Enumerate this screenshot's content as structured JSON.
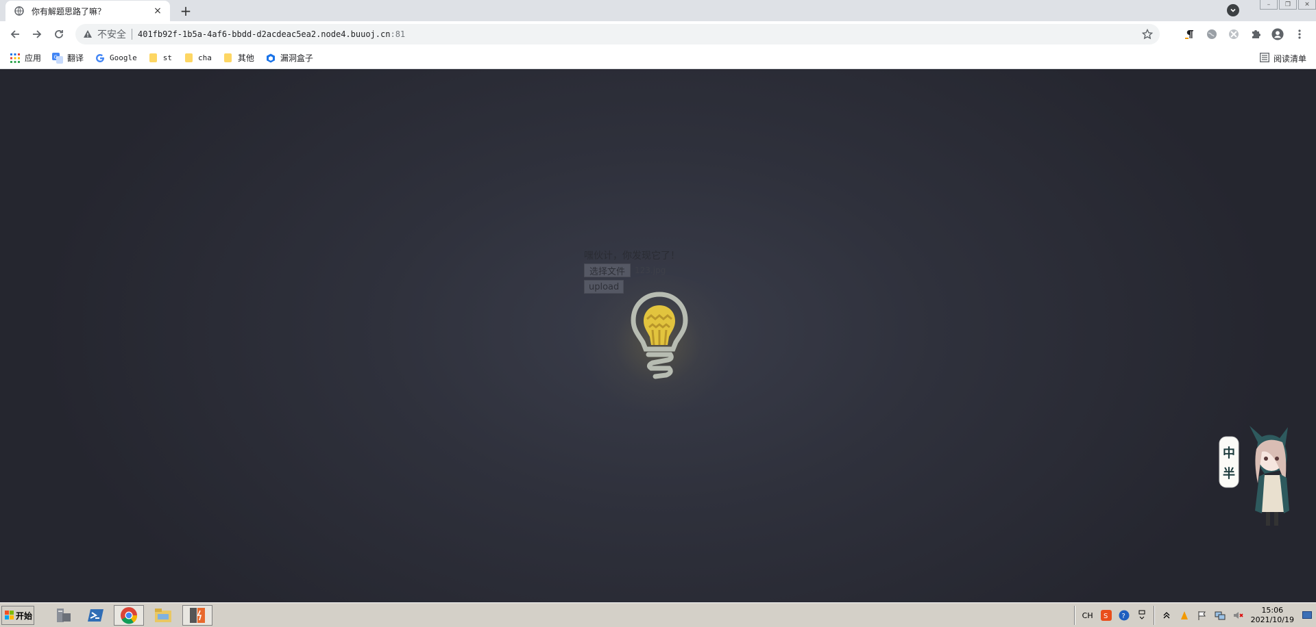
{
  "browser": {
    "tab": {
      "title": "你有解题思路了嘛？",
      "close": "×"
    },
    "new_tab": "+",
    "address": {
      "security_label": "不安全",
      "url_host": "401fb92f-1b5a-4af6-bbdd-d2acdeac5ea2.node4.buuoj.cn",
      "url_port": ":81"
    },
    "bookmarks": [
      {
        "label": "应用",
        "icon": "apps-grid-icon"
      },
      {
        "label": "翻译",
        "icon": "translate-icon"
      },
      {
        "label": "Google",
        "icon": "google-icon"
      },
      {
        "label": "st",
        "icon": "folder-icon"
      },
      {
        "label": "cha",
        "icon": "folder-icon"
      },
      {
        "label": "其他",
        "icon": "folder-icon"
      },
      {
        "label": "漏洞盒子",
        "icon": "vulbox-icon"
      }
    ],
    "reading_list": "阅读清单"
  },
  "page": {
    "hint": "嘿伙计，你发现它了！",
    "choose_file_label": "选择文件",
    "file_name": "123.jpg",
    "upload_label": "upload",
    "mascot_sign": [
      "中",
      "半"
    ]
  },
  "taskbar": {
    "start_label": "开始",
    "ime": "CH",
    "time": "15:06",
    "date": "2021/10/19"
  },
  "colors": {
    "tabstrip": "#dee1e6",
    "page_bg": "#2f313c",
    "bulb_yellow": "#e8c93a",
    "bulb_outline": "#b9bdb4"
  }
}
